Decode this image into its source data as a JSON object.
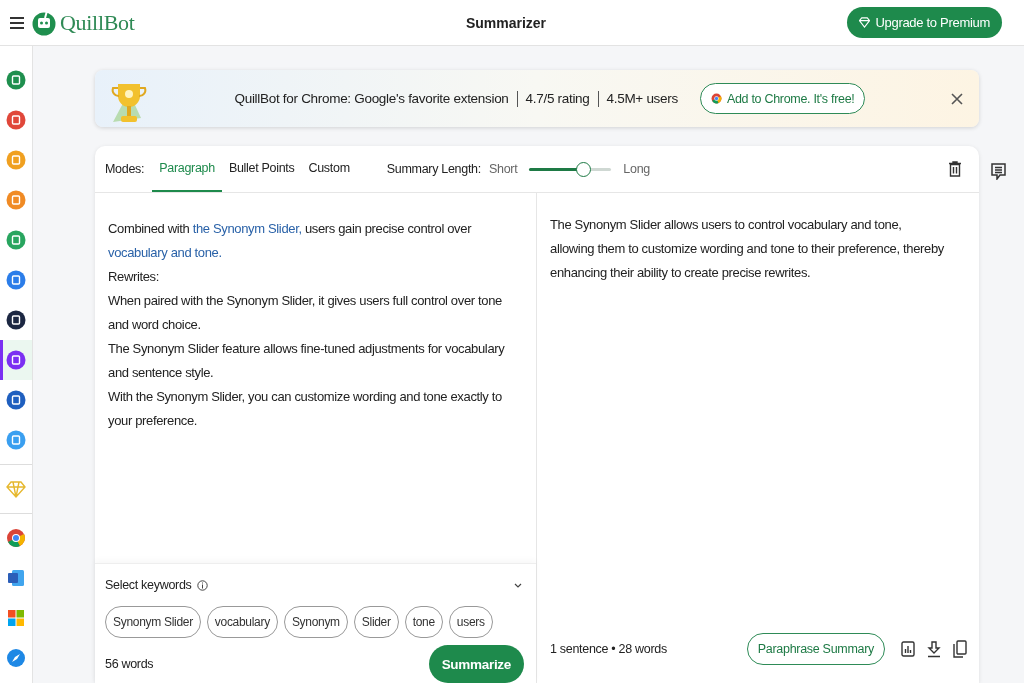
{
  "header": {
    "logo_text": "QuillBot",
    "title": "Summarizer",
    "upgrade_button": "Upgrade to Premium"
  },
  "sidebar": {
    "items": [
      {
        "kind": "tool",
        "color": "#1f8f4e",
        "selected": false
      },
      {
        "kind": "tool",
        "color": "#e0473a",
        "selected": false
      },
      {
        "kind": "tool",
        "color": "#f0a020",
        "selected": false
      },
      {
        "kind": "tool",
        "color": "#f08a24",
        "selected": false
      },
      {
        "kind": "tool",
        "color": "#28a55f",
        "selected": false
      },
      {
        "kind": "tool",
        "color": "#2b7de9",
        "selected": false
      },
      {
        "kind": "tool",
        "color": "#1c2742",
        "selected": false
      },
      {
        "kind": "tool",
        "color": "#7b2ff2",
        "selected": true
      },
      {
        "kind": "tool",
        "color": "#1f5fbf",
        "selected": false
      },
      {
        "kind": "tool",
        "color": "#3a9ff0",
        "selected": false
      },
      {
        "kind": "premium",
        "color": "#e6b82e",
        "selected": false
      },
      {
        "kind": "chrome",
        "color": "#db4437",
        "selected": false
      },
      {
        "kind": "word",
        "color": "#2b5eb8",
        "selected": false
      },
      {
        "kind": "microsoft",
        "selected": false
      },
      {
        "kind": "safari",
        "color": "#1e88e5",
        "selected": false
      }
    ]
  },
  "banner": {
    "message": "QuillBot for Chrome: Google's favorite extension",
    "rating": "4.7/5 rating",
    "users": "4.5M+ users",
    "button": "Add to Chrome. It's free!"
  },
  "toolbar": {
    "modes_label": "Modes:",
    "modes": [
      {
        "label": "Paragraph",
        "selected": true
      },
      {
        "label": "Bullet Points",
        "selected": false
      },
      {
        "label": "Custom",
        "selected": false
      }
    ],
    "length_label": "Summary Length:",
    "short_label": "Short",
    "long_label": "Long",
    "length": {
      "level": 0.66
    }
  },
  "input": {
    "paragraphs": [
      [
        {
          "text": "Combined with ",
          "link": false
        },
        {
          "text": "the Synonym Slider,",
          "link": true
        },
        {
          "text": " users gain precise control over ",
          "link": false
        },
        {
          "text": "vocabulary and tone.",
          "link": true
        }
      ],
      [
        {
          "text": "Rewrites:",
          "link": false
        }
      ],
      [
        {
          "text": "When paired with the Synonym Slider, it gives users full control over tone and word choice.",
          "link": false
        }
      ],
      [
        {
          "text": "The Synonym Slider feature allows fine-tuned adjustments for vocabulary and sentence style.",
          "link": false
        }
      ],
      [
        {
          "text": "With the Synonym Slider, you can customize wording and tone exactly to your preference.",
          "link": false
        }
      ]
    ],
    "keywords_label": "Select keywords",
    "keywords": [
      "Synonym Slider",
      "vocabulary",
      "Synonym",
      "Slider",
      "tone",
      "users"
    ],
    "word_count": "56 words",
    "summarize_button": "Summarize"
  },
  "output": {
    "text": "The Synonym Slider allows users to control vocabulary and tone, allowing them to customize wording and tone to their preference, thereby enhancing their ability to create precise rewrites.",
    "sentences": "1 sentence",
    "separator": "•",
    "words": "28 words",
    "paraphrase_button": "Paraphrase Summary"
  }
}
